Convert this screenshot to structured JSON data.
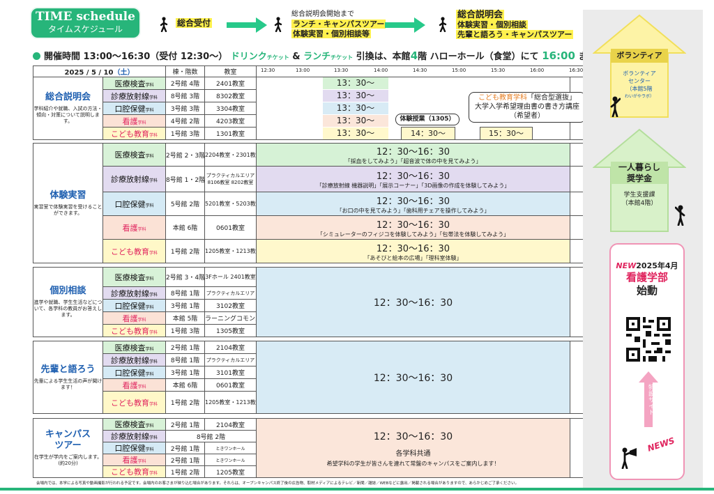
{
  "header": {
    "title": "TIME schedule",
    "subtitle": "タイムスケジュール"
  },
  "flow": {
    "step1": "総合受付",
    "step2_title": "総合説明会開始まで",
    "step2_l1": "ランチ・キャンパスツアー",
    "step2_l2": "体験実習・個別相談等",
    "step3_title": "総合説明会",
    "step3_l1": "体験実習・個別相談",
    "step3_l2": "先輩と語ろう・キャンパスツアー"
  },
  "info": {
    "label": "開催時間 13:00〜16:30（受付 12:30〜）",
    "drink": "ドリンク",
    "ticket1": "チケット",
    "amp": " & ",
    "lunch": "ランチ",
    "ticket2": "チケット",
    "exchange": " 引換は、本館",
    "floor": "4",
    "floor_unit": "階 ハローホール（食堂）にて",
    "until_time": "16:00",
    "until": "まで"
  },
  "table_header": {
    "date": "2025 / 5 / 10",
    "dow": "（土）",
    "building": "棟・階数",
    "room": "教室",
    "times": [
      "12:30",
      "13:00",
      "13:30",
      "14:00",
      "14:30",
      "15:00",
      "15:30",
      "16:00",
      "16:30"
    ]
  },
  "sections": {
    "s1": {
      "title": "総合説明会",
      "desc": "学科紹介や就職、入試の方法・傾向・対策について説明します。"
    },
    "s2": {
      "title": "体験実習",
      "desc": "実習室で体験実習を受けることができます。"
    },
    "s3": {
      "title": "個別相談",
      "desc": "進学や就職、学生生活などについて、各学科の教員がお答えします。"
    },
    "s4": {
      "title": "先輩と語ろう",
      "desc": "先輩による学生生活の声が聞けます！"
    },
    "s5": {
      "title": "キャンパスツアー",
      "desc": "在学生が学内をご案内します。(約20分)"
    }
  },
  "depts": [
    "医療検査",
    "診療放射線",
    "口腔保健",
    "看護",
    "こども教育"
  ],
  "dept_suffix": "学科",
  "rows": {
    "s1": [
      {
        "bld": "2号館 4階",
        "room": "2401教室"
      },
      {
        "bld": "8号館 3階",
        "room": "8302教室"
      },
      {
        "bld": "3号館 3階",
        "room": "3304教室"
      },
      {
        "bld": "4号館 2階",
        "room": "4203教室"
      },
      {
        "bld": "1号館 3階",
        "room": "1301教室"
      }
    ],
    "s2": [
      {
        "bld": "2号館 2・3階",
        "room": "2204教室・2301教室"
      },
      {
        "bld": "8号館 1・2階",
        "room": "プラクティカルエリア 8106教室 8202教室"
      },
      {
        "bld": "5号館 2階",
        "room": "5201教室・5203教室"
      },
      {
        "bld": "本館 6階",
        "room": "0601教室"
      },
      {
        "bld": "1号館 2階",
        "room": "1205教室・1213教室"
      }
    ],
    "s3": [
      {
        "bld": "2号館 3・4階",
        "room": "3Fホール 2401教室"
      },
      {
        "bld": "8号館 1階",
        "room": "プラクティカルエリア"
      },
      {
        "bld": "3号館 1階",
        "room": "3102教室"
      },
      {
        "bld": "本館 5階",
        "room": "ラーニングコモンズ"
      },
      {
        "bld": "1号館 3階",
        "room": "1305教室"
      }
    ],
    "s4": [
      {
        "bld": "2号館 1階",
        "room": "2104教室"
      },
      {
        "bld": "8号館 1階",
        "room": "プラクティカルエリア"
      },
      {
        "bld": "3号館 1階",
        "room": "3101教室"
      },
      {
        "bld": "本館 6階",
        "room": "0601教室"
      },
      {
        "bld": "1号館 2階",
        "room": "1205教室・1213教室"
      }
    ],
    "s5": [
      {
        "bld": "2号館 1階",
        "room": "2104教室"
      },
      {
        "bld": "8号館 2階",
        "room": ""
      },
      {
        "bld": "2号館 1階",
        "room": "ときワンホール"
      },
      {
        "bld": "2号館 1階",
        "room": "ときワンホール"
      },
      {
        "bld": "1号館 2階",
        "room": "1205教室"
      }
    ]
  },
  "s1_time": "13：30〜",
  "s1_bubble": {
    "dept": "こども教育学科",
    "l1": "「総合型選抜」",
    "l2": "大学入学希望理由書の書き方講座",
    "l3": "（希望者）"
  },
  "s1_trial": "体験授業（1305）",
  "s1_t1": "14：30〜",
  "s1_t2": "15：30〜",
  "range": "12：30〜16：30",
  "s2_details": [
    "「採血をしてみよう」「超音波で体の中を見てみよう」",
    "「診療放射線 機器説明」「展示コーナー」「3D画像の作成を体験してみよう」",
    "「お口の中を見てみよう」「歯科用チェアを操作してみよう」",
    "「シミュレーターのフィジコを体験してみよう」「包帯法を体験してみよう」",
    "「あそびと絵本の広場」「理科室体験」"
  ],
  "s5_common": "各学科共通",
  "s5_note": "希望学科の学生が皆さんを連れて常盤のキャンパスをご案内します！",
  "side": {
    "volunteer_title": "ボランティア",
    "volunteer_l1": "ボランティア",
    "volunteer_l2": "センター",
    "volunteer_l3": "（本館5階",
    "volunteer_l4": "わいがやラボ）",
    "life_title1": "一人暮らし",
    "life_title2": "奨学金",
    "life_l1": "学生支援課",
    "life_l2": "（本館4階）",
    "new": "NEW",
    "news_date": "2025年4月",
    "news_l1": "看護学部",
    "news_l2": "始動",
    "special": "特設サイト",
    "news": "NEWS"
  },
  "footer": "会場内では、本学による写真や動画撮影が行われる予定です。会場内のお客さまが映り込む場合があります。それらは、オープンキャンパス終了後の広告物、取材メディアによるテレビ／新聞／雑誌／WEBなどに露出／掲載される場合がありますので、あらかじめご了承ください。",
  "colors": {
    "accent": "#27b57a",
    "blue": "#1e5fb0",
    "pink": "#e0245e"
  }
}
